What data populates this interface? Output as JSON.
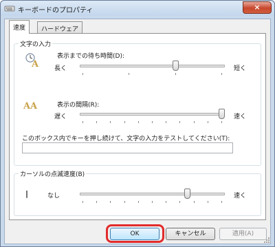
{
  "window": {
    "title": "キーボードのプロパティ",
    "close_glyph": "×"
  },
  "tabs": [
    {
      "label": "速度",
      "selected": true
    },
    {
      "label": "ハードウェア",
      "selected": false
    }
  ],
  "input_group": {
    "title": "文字の入力",
    "delay": {
      "label": "表示までの待ち時間(D):",
      "min_label": "長く",
      "max_label": "短く",
      "level": 0.67,
      "tick_count": 4
    },
    "rate": {
      "label": "表示の間隔(R):",
      "min_label": "遅く",
      "max_label": "速く",
      "level": 1.0,
      "tick_count": 11
    },
    "test_label": "このボックス内でキーを押し続けて、文字の入力をテストしてください(T):",
    "test_value": ""
  },
  "cursor_group": {
    "title": "カーソルの点滅速度(B)",
    "min_label": "なし",
    "max_label": "速く",
    "cursor_glyph": "|",
    "level": 0.75,
    "tick_count": 11
  },
  "buttons": {
    "ok": "OK",
    "cancel": "キャンセル",
    "apply": "適用(A)"
  },
  "colors": {
    "highlight": "#e22b2b",
    "title_bar": "#c9d9ec"
  }
}
